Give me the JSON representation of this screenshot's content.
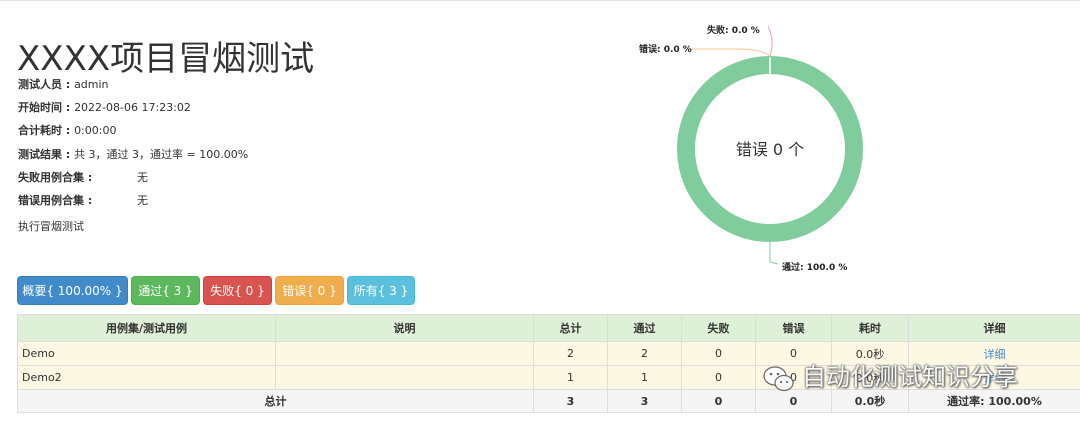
{
  "report": {
    "title": "XXXX项目冒烟测试",
    "info": [
      {
        "key": "测试人员 : ",
        "value": "admin"
      },
      {
        "key": "开始时间 : ",
        "value": "2022-08-06 17:23:02"
      },
      {
        "key": "合计耗时 : ",
        "value": "0:00:00"
      },
      {
        "key": "测试结果 : ",
        "value": "共 3，通过 3，通过率 = 100.00%"
      },
      {
        "key": "失败用例合集 :",
        "value": "无"
      },
      {
        "key": "错误用例合集 :",
        "value": "无"
      }
    ],
    "description": "执行冒烟测试"
  },
  "chart_data": {
    "type": "pie",
    "center_label": "错误 0 个",
    "slices": [
      {
        "label": "失败",
        "percent": 0.0,
        "display": "失败: 0.0 %",
        "color": "#f4a0a0"
      },
      {
        "label": "错误",
        "percent": 0.0,
        "display": "错误: 0.0 %",
        "color": "#f4c98e"
      },
      {
        "label": "通过",
        "percent": 100.0,
        "display": "通过: 100.0 %",
        "color": "#81cc9c"
      }
    ]
  },
  "buttons": {
    "summary": "概要{ 100.00% }",
    "pass": "通过{ 3 }",
    "fail": "失败{ 0 }",
    "error": "错误{ 0 }",
    "all": "所有{ 3 }"
  },
  "table": {
    "headers": [
      "用例集/测试用例",
      "说明",
      "总计",
      "通过",
      "失败",
      "错误",
      "耗时",
      "详细"
    ],
    "rows": [
      {
        "name": "Demo",
        "desc": "",
        "total": "2",
        "pass": "2",
        "fail": "0",
        "error": "0",
        "time": "0.0秒",
        "detail": "详细"
      },
      {
        "name": "Demo2",
        "desc": "",
        "total": "1",
        "pass": "1",
        "fail": "0",
        "error": "0",
        "time": "0.0秒",
        "detail": "详细"
      }
    ],
    "footer": {
      "label": "总计",
      "total": "3",
      "pass": "3",
      "fail": "0",
      "error": "0",
      "time": "0.0秒",
      "rate": "通过率:  100.00%"
    }
  },
  "watermark": {
    "text": "自动化测试知识分享",
    "icon": "wechat-icon"
  },
  "colors": {
    "primary": "#428bca",
    "success": "#5cb85c",
    "danger": "#d9534f",
    "warning": "#f0ad4e",
    "info": "#5bc0de",
    "donut": "#81cc9c"
  }
}
